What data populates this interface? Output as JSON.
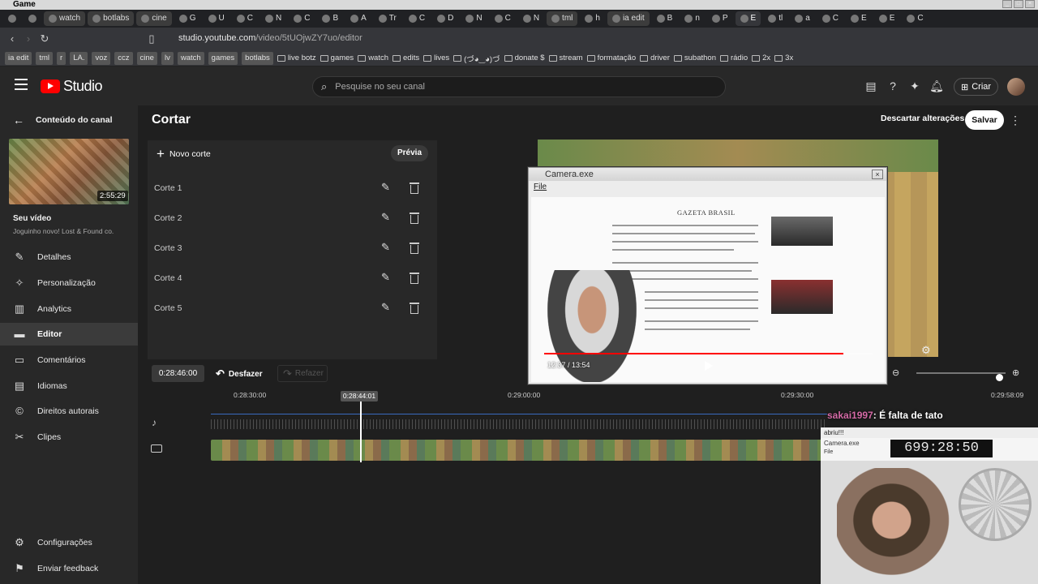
{
  "os": {
    "title": "Game"
  },
  "tabs": [
    {
      "kind": "icon"
    },
    {
      "kind": "icon"
    },
    {
      "kind": "text",
      "label": "watch"
    },
    {
      "kind": "text",
      "label": "botlabs"
    },
    {
      "kind": "text",
      "label": "cine"
    },
    {
      "kind": "short",
      "label": "G"
    },
    {
      "kind": "short",
      "label": "U"
    },
    {
      "kind": "short",
      "label": "C"
    },
    {
      "kind": "short",
      "label": "N"
    },
    {
      "kind": "short",
      "label": "C"
    },
    {
      "kind": "short",
      "label": "B"
    },
    {
      "kind": "short",
      "label": "A"
    },
    {
      "kind": "short",
      "label": "Tr"
    },
    {
      "kind": "short",
      "label": "C"
    },
    {
      "kind": "short",
      "label": "D"
    },
    {
      "kind": "short",
      "label": "N"
    },
    {
      "kind": "short",
      "label": "C"
    },
    {
      "kind": "short",
      "label": "N"
    },
    {
      "kind": "text",
      "label": "tml"
    },
    {
      "kind": "short",
      "label": "h"
    },
    {
      "kind": "text",
      "label": "ia edit"
    },
    {
      "kind": "short",
      "label": "B"
    },
    {
      "kind": "short",
      "label": "n"
    },
    {
      "kind": "short",
      "label": "P"
    },
    {
      "kind": "active",
      "label": "E"
    },
    {
      "kind": "short",
      "label": "tl"
    },
    {
      "kind": "short",
      "label": "a"
    },
    {
      "kind": "short",
      "label": "C"
    },
    {
      "kind": "short",
      "label": "E"
    },
    {
      "kind": "short",
      "label": "E"
    },
    {
      "kind": "short",
      "label": "C"
    }
  ],
  "browser": {
    "url_host": "studio.youtube.com",
    "url_path": "/video/5tUOjwZY7uo/editor"
  },
  "bookmarks": [
    {
      "label": "ia edit",
      "box": true
    },
    {
      "label": "tml",
      "box": true
    },
    {
      "label": "r",
      "box": true
    },
    {
      "label": "LA.",
      "box": true
    },
    {
      "label": "voz",
      "box": true
    },
    {
      "label": "ccz",
      "box": true
    },
    {
      "label": "cine",
      "box": true
    },
    {
      "label": "lv",
      "box": true
    },
    {
      "label": "watch",
      "box": true
    },
    {
      "label": "games",
      "box": true
    },
    {
      "label": "botlabs",
      "box": true
    },
    {
      "label": "live botz",
      "box": false
    },
    {
      "label": "games",
      "box": false
    },
    {
      "label": "watch",
      "box": false
    },
    {
      "label": "edits",
      "box": false
    },
    {
      "label": "lives",
      "box": false
    },
    {
      "label": "(づ◕‿◕)づ",
      "box": false
    },
    {
      "label": "donate $",
      "box": false
    },
    {
      "label": "stream",
      "box": false
    },
    {
      "label": "formatação",
      "box": false
    },
    {
      "label": "driver",
      "box": false
    },
    {
      "label": "subathon",
      "box": false
    },
    {
      "label": "rádio",
      "box": false
    },
    {
      "label": "2x",
      "box": false
    },
    {
      "label": "3x",
      "box": false
    }
  ],
  "header": {
    "logo_text": "Studio",
    "search_placeholder": "Pesquise no seu canal",
    "create_label": "Criar"
  },
  "sidebar": {
    "back_label": "Conteúdo do canal",
    "thumb_duration": "2:55:29",
    "your_video": "Seu vídeo",
    "video_title": "Joguinho novo! Lost & Found co.",
    "items": [
      {
        "label": "Detalhes",
        "icon": "pencil-icon"
      },
      {
        "label": "Personalização",
        "icon": "magic-icon"
      },
      {
        "label": "Analytics",
        "icon": "bar-chart-icon"
      },
      {
        "label": "Editor",
        "icon": "film-icon",
        "active": true
      },
      {
        "label": "Comentários",
        "icon": "comment-icon"
      },
      {
        "label": "Idiomas",
        "icon": "subtitles-icon"
      },
      {
        "label": "Direitos autorais",
        "icon": "copyright-icon"
      },
      {
        "label": "Clipes",
        "icon": "scissors-icon"
      }
    ],
    "footer": [
      {
        "label": "Configurações",
        "icon": "gear-icon"
      },
      {
        "label": "Enviar feedback",
        "icon": "feedback-icon"
      }
    ]
  },
  "main": {
    "title": "Cortar",
    "discard_label": "Descartar alterações",
    "save_label": "Salvar",
    "new_cut_label": "Novo corte",
    "preview_label": "Prévia",
    "cuts": [
      "Corte 1",
      "Corte 2",
      "Corte 3",
      "Corte 4",
      "Corte 5"
    ]
  },
  "preview": {
    "camera_title": "Camera.exe",
    "camera_menu": "File",
    "news_site": "GAZETA BRASIL",
    "player_time": "12:37 / 13:54",
    "player_progress": 0.91
  },
  "timeline": {
    "current_time": "0:28:46:00",
    "undo_label": "Desfazer",
    "redo_label": "Refazer",
    "playhead_time": "0:28:44:01",
    "ticks": [
      "0:28:30:00",
      "0:29:00:00",
      "0:29:30:00",
      "0:29:58:09"
    ]
  },
  "overlay": {
    "chat_user": "sakai1997",
    "chat_text": ": É falta de tato",
    "cam2_top": "abriu!!!",
    "cam2_title": "Camera.exe",
    "cam2_file": "File",
    "clock": "699:28:50"
  }
}
